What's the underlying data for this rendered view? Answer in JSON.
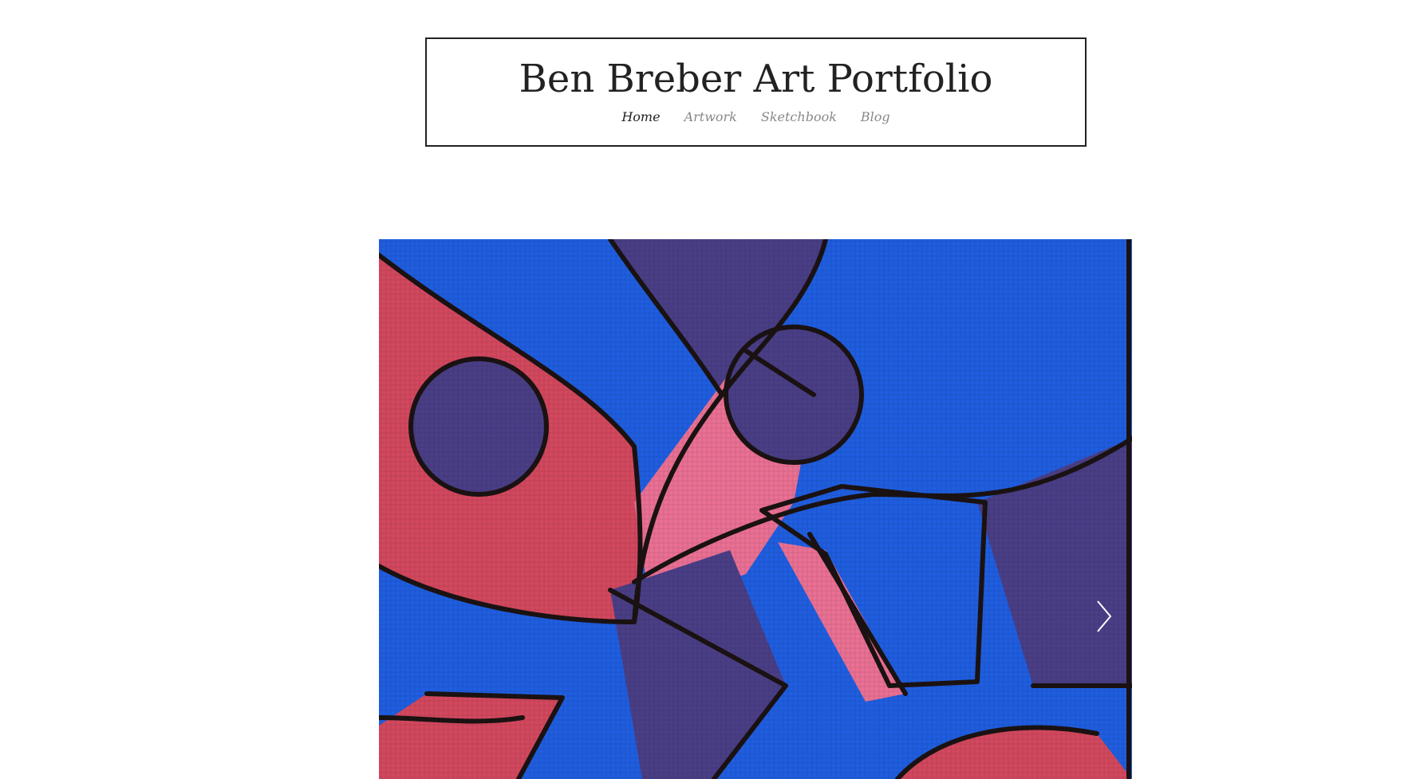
{
  "site": {
    "title": "Ben Breber Art Portfolio"
  },
  "nav": {
    "items": [
      {
        "label": "Home",
        "active": true
      },
      {
        "label": "Artwork",
        "active": false
      },
      {
        "label": "Sketchbook",
        "active": false
      },
      {
        "label": "Blog",
        "active": false
      }
    ]
  },
  "slideshow": {
    "next_icon": "chevron-right-icon",
    "artwork_colors": {
      "blue": "#1f5ee0",
      "violet": "#4a3e86",
      "crimson": "#d2485e",
      "pink": "#ea7094",
      "outline": "#1a1212"
    }
  }
}
